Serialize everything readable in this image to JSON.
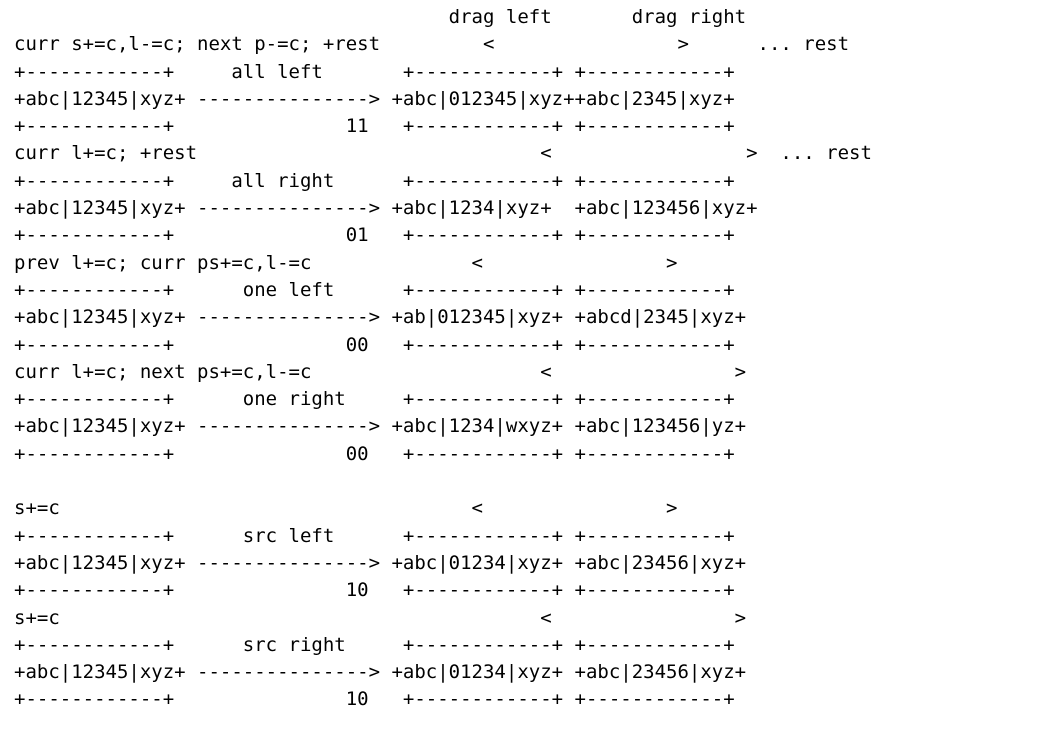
{
  "lines": [
    "                                      drag left       drag right",
    "curr s+=c,l-=c; next p-=c; +rest         <                >      ... rest",
    "+------------+     all left       +------------+ +------------+",
    "+abc|12345|xyz+ ---------------> +abc|012345|xyz++abc|2345|xyz+",
    "+------------+               11   +------------+ +------------+",
    "curr l+=c; +rest                              <                 >  ... rest",
    "+------------+     all right      +------------+ +------------+",
    "+abc|12345|xyz+ ---------------> +abc|1234|xyz+  +abc|123456|xyz+",
    "+------------+               01   +------------+ +------------+",
    "prev l+=c; curr ps+=c,l-=c              <                >",
    "+------------+      one left      +------------+ +------------+",
    "+abc|12345|xyz+ ---------------> +ab|012345|xyz+ +abcd|2345|xyz+",
    "+------------+               00   +------------+ +------------+",
    "curr l+=c; next ps+=c,l-=c                    <                >",
    "+------------+      one right     +------------+ +------------+",
    "+abc|12345|xyz+ ---------------> +abc|1234|wxyz+ +abc|123456|yz+",
    "+------------+               00   +------------+ +------------+",
    "",
    "s+=c                                    <                >",
    "+------------+      src left      +------------+ +------------+",
    "+abc|12345|xyz+ ---------------> +abc|01234|xyz+ +abc|23456|xyz+",
    "+------------+               10   +------------+ +------------+",
    "s+=c                                          <                >",
    "+------------+      src right     +------------+ +------------+",
    "+abc|12345|xyz+ ---------------> +abc|01234|xyz+ +abc|23456|xyz+",
    "+------------+               10   +------------+ +------------+"
  ]
}
